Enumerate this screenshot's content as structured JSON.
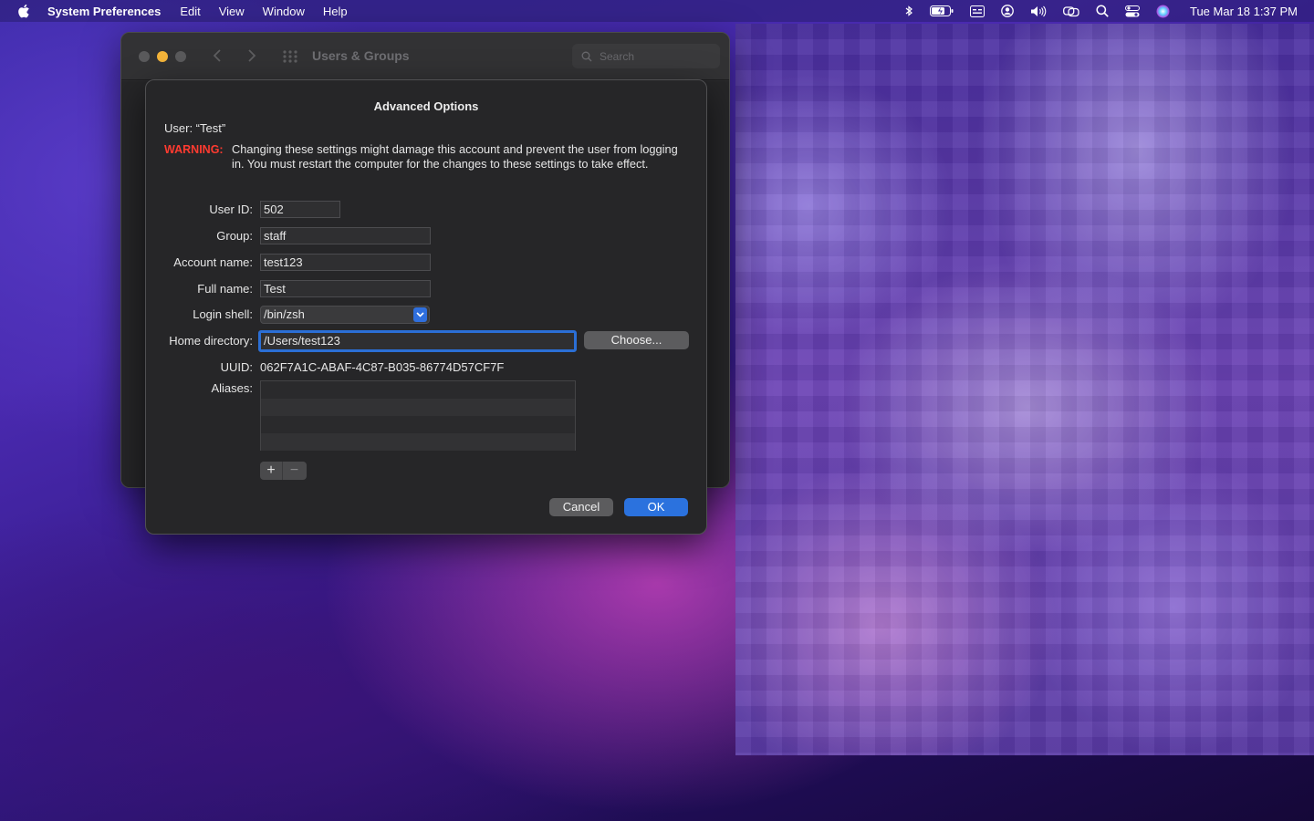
{
  "menubar": {
    "app_name": "System Preferences",
    "items": [
      "Edit",
      "View",
      "Window",
      "Help"
    ],
    "clock": "Tue Mar 18  1:37 PM",
    "status_icons": [
      "bluetooth-icon",
      "battery-icon",
      "input-menu-icon",
      "user-icon",
      "volume-icon",
      "screen-mirroring-icon",
      "spotlight-icon",
      "control-center-icon",
      "siri-icon"
    ]
  },
  "window": {
    "title": "Users & Groups",
    "search_placeholder": "Search"
  },
  "sheet": {
    "title": "Advanced Options",
    "user_label": "User:  “Test”",
    "warning_label": "WARNING:",
    "warning_text": "Changing these settings might damage this account and prevent the user from logging in. You must restart the computer for the changes to these settings to take effect.",
    "fields": {
      "user_id_label": "User ID:",
      "user_id_value": "502",
      "group_label": "Group:",
      "group_value": "staff",
      "account_name_label": "Account name:",
      "account_name_value": "test123",
      "full_name_label": "Full name:",
      "full_name_value": "Test",
      "login_shell_label": "Login shell:",
      "login_shell_value": "/bin/zsh",
      "home_directory_label": "Home directory:",
      "home_directory_value": "/Users/test123",
      "uuid_label": "UUID:",
      "uuid_value": "062F7A1C-ABAF-4C87-B035-86774D57CF7F",
      "aliases_label": "Aliases:"
    },
    "buttons": {
      "choose": "Choose...",
      "add": "+",
      "remove": "−",
      "cancel": "Cancel",
      "ok": "OK"
    }
  },
  "colors": {
    "accent": "#2b72de",
    "warning": "#ff3b30",
    "minimize": "#f4b43a"
  }
}
